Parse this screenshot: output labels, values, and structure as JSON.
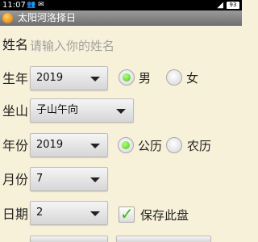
{
  "status_bar": {
    "time": "11:07",
    "left_glyphs": "👥 ✉",
    "signal": "◢",
    "battery": "93"
  },
  "app": {
    "title": "太阳河洛择日",
    "icon": "sun-face-icon"
  },
  "form": {
    "name": {
      "label": "姓名",
      "placeholder": "请输入你的姓名",
      "value": ""
    },
    "birth_year": {
      "label": "生年",
      "value": "2019",
      "gender_options": [
        {
          "label": "男",
          "selected": true
        },
        {
          "label": "女",
          "selected": false
        }
      ]
    },
    "sitting": {
      "label": "坐山",
      "value": "子山午向"
    },
    "year": {
      "label": "年份",
      "value": "2019",
      "calendar_options": [
        {
          "label": "公历",
          "selected": true
        },
        {
          "label": "农历",
          "selected": false
        }
      ]
    },
    "month": {
      "label": "月份",
      "value": "7"
    },
    "day": {
      "label": "日期",
      "value": "2",
      "save_checkbox": {
        "label": "保存此盘",
        "checked": true
      }
    }
  },
  "colors": {
    "background": "#f8f1d9",
    "title_bar": "#7a7a7a",
    "radio_selected": "#43c51a",
    "check_mark": "#3db817",
    "placeholder_text": "#a0a0a0"
  }
}
